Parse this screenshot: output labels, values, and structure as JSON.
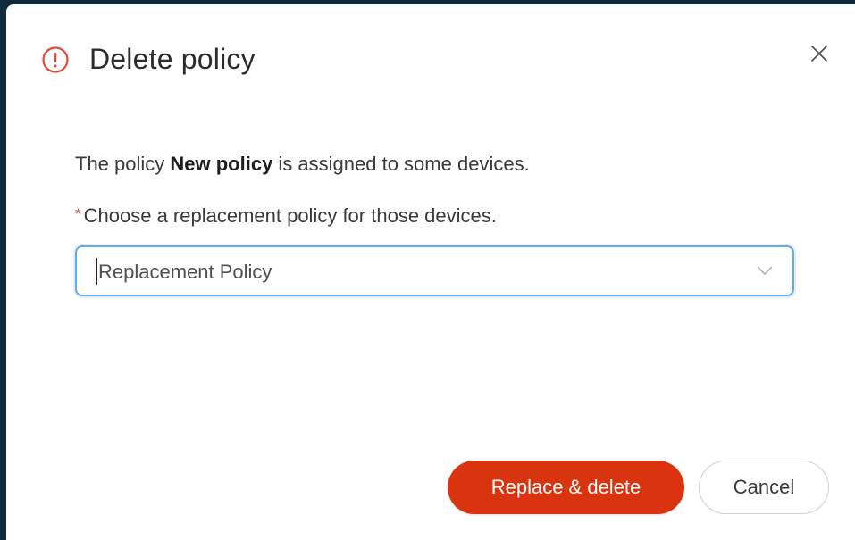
{
  "dialog": {
    "title": "Delete policy",
    "icon": "warning-circle-icon",
    "close_icon": "close-icon",
    "message_prefix": "The policy ",
    "policy_name": "New policy",
    "message_suffix": " is assigned to some devices.",
    "required_marker": "*",
    "instruction": "Choose a replacement policy for those devices.",
    "select": {
      "placeholder": "Replacement Policy",
      "icon": "chevron-down-icon"
    },
    "buttons": {
      "primary_label": "Replace & delete",
      "secondary_label": "Cancel"
    }
  },
  "colors": {
    "accent": "#d9340f",
    "warning": "#e04b34",
    "focus_border": "#6aa8ee",
    "backdrop": "#0f2a3a"
  }
}
